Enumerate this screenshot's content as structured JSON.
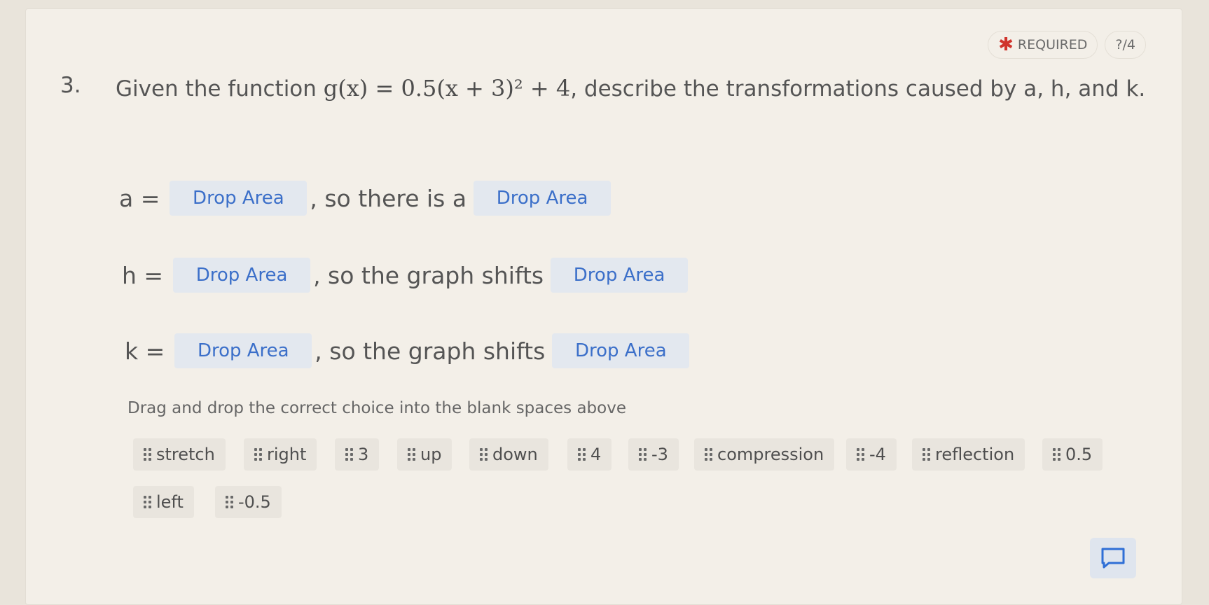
{
  "header": {
    "required_label": "REQUIRED",
    "score": "?/4"
  },
  "question": {
    "number": "3.",
    "prefix": "Given the function",
    "formula": "g(x) = 0.5(x + 3)² + 4",
    "suffix": ", describe the transformations caused by a, h, and k."
  },
  "rows": [
    {
      "var": "a =",
      "drop1": "Drop Area",
      "middle": ", so there is a",
      "drop2": "Drop Area"
    },
    {
      "var": "h =",
      "drop1": "Drop Area",
      "middle": ", so the graph shifts",
      "drop2": "Drop Area"
    },
    {
      "var": "k =",
      "drop1": "Drop Area",
      "middle": ", so the graph shifts",
      "drop2": "Drop Area"
    }
  ],
  "instruction": "Drag and drop the correct choice into the blank spaces above",
  "choices": [
    "stretch",
    "right",
    "3",
    "up",
    "down",
    "4",
    "-3",
    "compression",
    "-4",
    "reflection",
    "0.5",
    "left",
    "-0.5"
  ],
  "icons": {
    "required": "asterisk-icon",
    "grip": "drag-handle-icon",
    "feedback": "comment-icon"
  },
  "colors": {
    "required_star": "#d0342c",
    "drop_area_text": "#3b6fc9",
    "drop_area_bg": "#e3e8ef"
  }
}
